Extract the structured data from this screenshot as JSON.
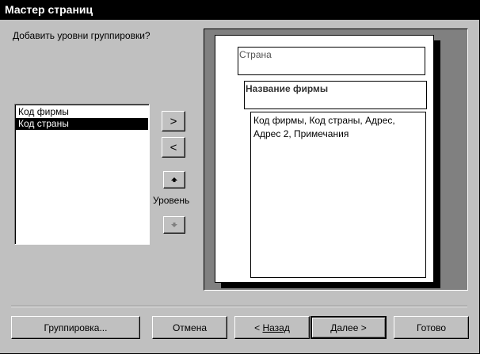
{
  "window": {
    "title": "Мастер страниц"
  },
  "prompt": "Добавить уровни группировки?",
  "fields_list": {
    "items": [
      {
        "label": "Код фирмы",
        "selected": false
      },
      {
        "label": "Код страны",
        "selected": true
      }
    ]
  },
  "move_buttons": {
    "add": ">",
    "remove": "<",
    "priority_up": "up-arrow-icon",
    "priority_down": "down-arrow-icon",
    "level_label": "Уровень"
  },
  "preview": {
    "group1": "Страна",
    "group2": "Название фирмы",
    "detail_fields": "Код фирмы, Код страны, Адрес, Адрес 2, Примечания"
  },
  "footer": {
    "grouping": "Группировка...",
    "cancel": "Отмена",
    "back_prefix": "< ",
    "back": "Назад",
    "next": "Далее >",
    "finish": "Готово"
  }
}
